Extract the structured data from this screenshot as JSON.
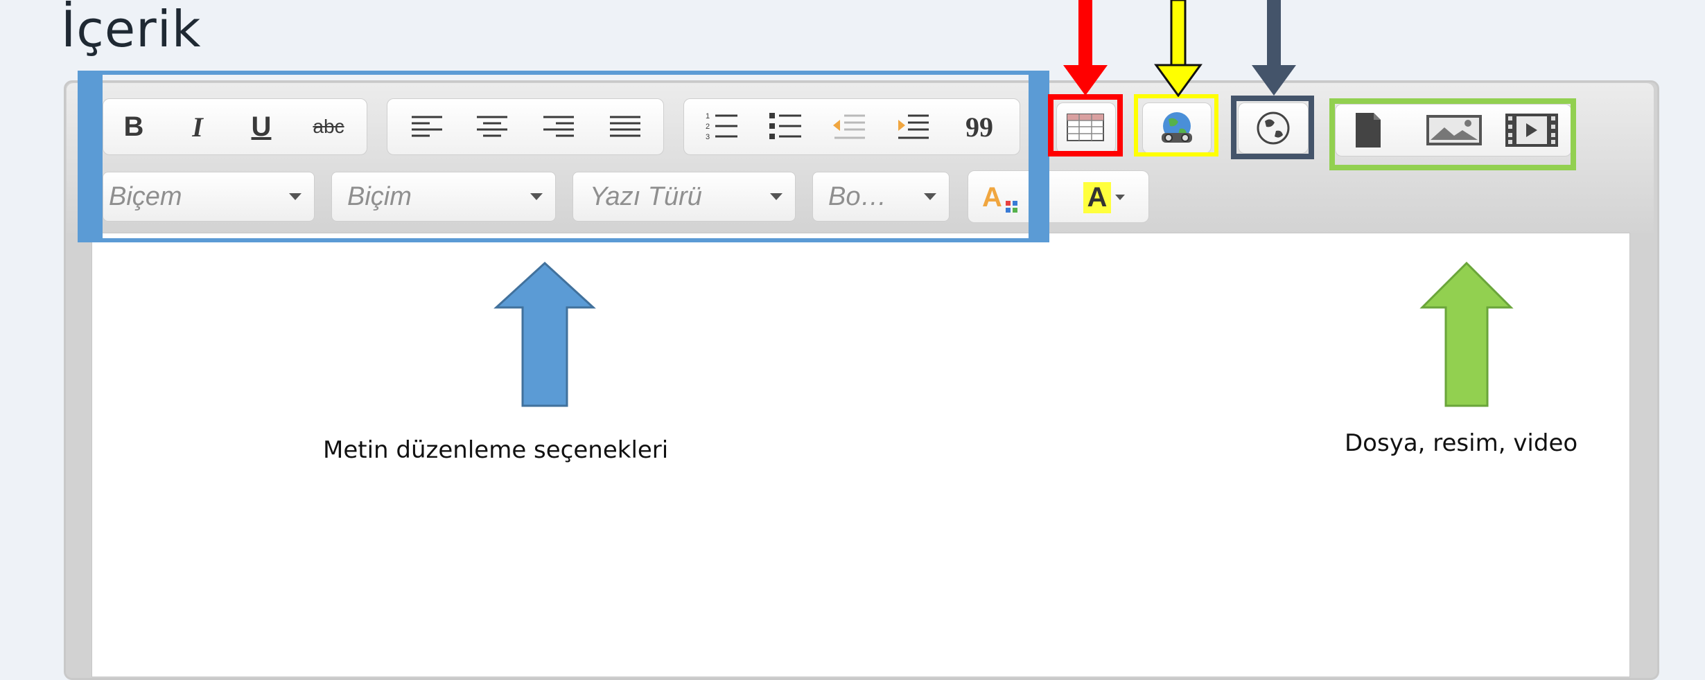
{
  "page": {
    "title": "İçerik"
  },
  "toolbar": {
    "style_combo": "Biçem",
    "format_combo": "Biçim",
    "font_combo": "Yazı Türü",
    "size_combo": "Bo…",
    "bold_label": "B",
    "italic_label": "I",
    "underline_label": "U",
    "strike_label": "abc",
    "blockquote_label": "99",
    "bgcolor_label": "A"
  },
  "annotations": {
    "text_options": "Metin düzenleme seçenekleri",
    "media_options": "Dosya, resim, video"
  },
  "colors": {
    "blue_box": "#5b9bd5",
    "red_box": "#ff0000",
    "yellow_box": "#ffff00",
    "gray_box": "#44546a",
    "green_box": "#92d050"
  }
}
